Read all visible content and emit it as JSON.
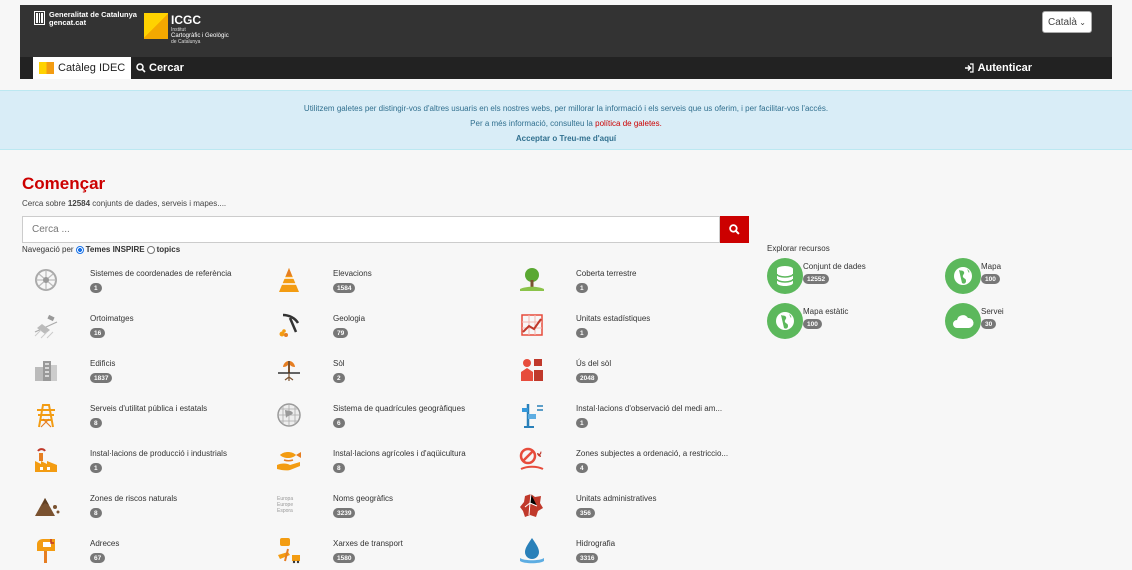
{
  "header": {
    "gencat_line1": "Generalitat de Catalunya",
    "gencat_line2": "gencat.cat",
    "icgc_name": "ICGC",
    "icgc_sub1": "Institut",
    "icgc_sub2": "Cartogràfic i Geològic",
    "icgc_sub3": "de Catalunya",
    "language": "Català",
    "tab_catalog": "Catàleg IDEC",
    "tab_search": "Cercar",
    "auth": "Autenticar"
  },
  "cookie": {
    "line1": "Utilitzem galetes per distingir-vos d'altres usuaris en els nostres webs, per millorar la informació i els serveis que us oferim, i per facilitar-vos l'accés.",
    "line2_prefix": "Per a més informació, consulteu la",
    "line2_link": "política de galetes.",
    "accept": "Acceptar",
    "or": "o",
    "dismiss": "Treu-me d'aquí"
  },
  "main": {
    "title": "Començar",
    "subtitle_prefix": "Cerca sobre",
    "subtitle_count": "12584",
    "subtitle_suffix": "conjunts de dades, serveis i mapes....",
    "search_placeholder": "Cerca ...",
    "nav_label": "Navegació per",
    "nav_option1": "Temes INSPIRE",
    "nav_option2": "topics"
  },
  "themes": [
    {
      "name": "Sistemes de coordenades de referència",
      "count": "1",
      "icon": "globe-network-icon"
    },
    {
      "name": "Elevacions",
      "count": "1584",
      "icon": "elevation-pyramid-icon"
    },
    {
      "name": "Coberta terrestre",
      "count": "1",
      "icon": "tree-land-icon"
    },
    {
      "name": "Ortoimatges",
      "count": "16",
      "icon": "satellite-icon"
    },
    {
      "name": "Geologia",
      "count": "79",
      "icon": "pickaxe-icon"
    },
    {
      "name": "Unitats estadístiques",
      "count": "1",
      "icon": "statistics-chart-icon"
    },
    {
      "name": "Edificis",
      "count": "1837",
      "icon": "buildings-icon"
    },
    {
      "name": "Sòl",
      "count": "2",
      "icon": "soil-sprout-icon"
    },
    {
      "name": "Ús del sòl",
      "count": "2048",
      "icon": "land-use-icon"
    },
    {
      "name": "Serveis d'utilitat pública i estatals",
      "count": "8",
      "icon": "power-tower-icon"
    },
    {
      "name": "Sistema de quadrícules geogràfiques",
      "count": "6",
      "icon": "grid-globe-icon"
    },
    {
      "name": "Instal·lacions d'observació del medi am...",
      "count": "1",
      "icon": "observation-station-icon"
    },
    {
      "name": "Instal·lacions de producció i industrials",
      "count": "1",
      "icon": "factory-icon"
    },
    {
      "name": "Instal·lacions agrícoles i d'aqüicultura",
      "count": "8",
      "icon": "fish-hand-icon"
    },
    {
      "name": "Zones subjectes a ordenació, a restriccio...",
      "count": "4",
      "icon": "restricted-zone-icon"
    },
    {
      "name": "Zones de riscos naturals",
      "count": "8",
      "icon": "natural-hazard-icon"
    },
    {
      "name": "Noms geogràfics",
      "count": "3239",
      "icon": "geographic-names-icon"
    },
    {
      "name": "Unitats administratives",
      "count": "356",
      "icon": "admin-map-icon"
    },
    {
      "name": "Adreces",
      "count": "67",
      "icon": "mailbox-icon"
    },
    {
      "name": "Xarxes de transport",
      "count": "1580",
      "icon": "transport-icon"
    },
    {
      "name": "Hidrografia",
      "count": "3316",
      "icon": "water-drop-icon"
    }
  ],
  "geogr_icon_text": [
    "Europa",
    "Europe",
    "Espora"
  ],
  "explore": {
    "title": "Explorar recursos",
    "items": [
      {
        "name": "Conjunt de dades",
        "count": "12552"
      },
      {
        "name": "Mapa",
        "count": "100"
      },
      {
        "name": "Mapa estàtic",
        "count": "100"
      },
      {
        "name": "Servei",
        "count": "30"
      }
    ]
  },
  "colors": {
    "accent_red": "#cc0000",
    "header_dark": "#333333",
    "resource_green": "#5cb85c",
    "icon_orange": "#f39c12"
  }
}
